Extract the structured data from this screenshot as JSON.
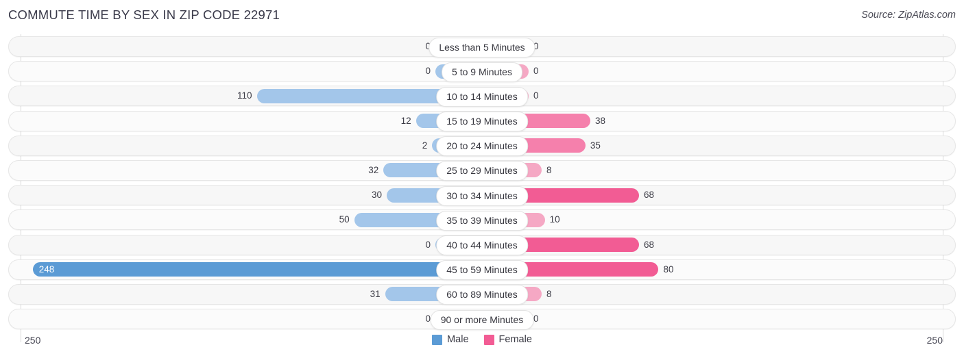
{
  "header": {
    "title": "COMMUTE TIME BY SEX IN ZIP CODE 22971",
    "source": "Source: ZipAtlas.com"
  },
  "legend": {
    "male_label": "Male",
    "female_label": "Female",
    "male_color": "#5b9bd5",
    "female_color": "#f25c94"
  },
  "axis": {
    "left_tick": "250",
    "right_tick": "250",
    "max": 250
  },
  "chart_data": {
    "type": "bar",
    "title": "COMMUTE TIME BY SEX IN ZIP CODE 22971",
    "subtitle": "Source: ZipAtlas.com",
    "orientation": "horizontal-diverging",
    "xlabel": "",
    "ylabel": "",
    "xlim": [
      250,
      250
    ],
    "grid": true,
    "legend_position": "bottom-center",
    "categories": [
      "Less than 5 Minutes",
      "5 to 9 Minutes",
      "10 to 14 Minutes",
      "15 to 19 Minutes",
      "20 to 24 Minutes",
      "25 to 29 Minutes",
      "30 to 34 Minutes",
      "35 to 39 Minutes",
      "40 to 44 Minutes",
      "45 to 59 Minutes",
      "60 to 89 Minutes",
      "90 or more Minutes"
    ],
    "series": [
      {
        "name": "Male",
        "values": [
          0,
          0,
          110,
          12,
          2,
          32,
          30,
          50,
          0,
          248,
          31,
          0
        ]
      },
      {
        "name": "Female",
        "values": [
          0,
          0,
          0,
          38,
          35,
          8,
          68,
          10,
          68,
          80,
          8,
          0
        ]
      }
    ]
  },
  "rows": [
    {
      "label": "Less than 5 Minutes",
      "male": "0",
      "female": "0"
    },
    {
      "label": "5 to 9 Minutes",
      "male": "0",
      "female": "0"
    },
    {
      "label": "10 to 14 Minutes",
      "male": "110",
      "female": "0"
    },
    {
      "label": "15 to 19 Minutes",
      "male": "12",
      "female": "38"
    },
    {
      "label": "20 to 24 Minutes",
      "male": "2",
      "female": "35"
    },
    {
      "label": "25 to 29 Minutes",
      "male": "32",
      "female": "8"
    },
    {
      "label": "30 to 34 Minutes",
      "male": "30",
      "female": "68"
    },
    {
      "label": "35 to 39 Minutes",
      "male": "50",
      "female": "10"
    },
    {
      "label": "40 to 44 Minutes",
      "male": "0",
      "female": "68"
    },
    {
      "label": "45 to 59 Minutes",
      "male": "248",
      "female": "80"
    },
    {
      "label": "60 to 89 Minutes",
      "male": "31",
      "female": "8"
    },
    {
      "label": "90 or more Minutes",
      "male": "0",
      "female": "0"
    }
  ]
}
